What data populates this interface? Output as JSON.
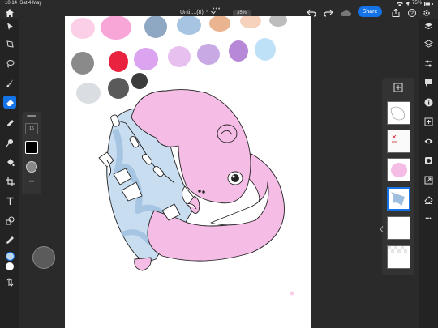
{
  "status": {
    "time": "10:14",
    "date": "Sat 4 May",
    "battery": "75%"
  },
  "header": {
    "doc_title": "Untit...(8)",
    "title_suffix": "*",
    "zoom": "35%",
    "share_label": "Share",
    "more_dots": "•••"
  },
  "brush_panel": {
    "size_value": "15"
  },
  "palette": {
    "swatches": [
      {
        "color": "#fbd0e6"
      },
      {
        "color": "#f7a6d7"
      },
      {
        "color": "#8ea7c2"
      },
      {
        "color": "#a7c4e2"
      },
      {
        "color": "#e9b48f"
      },
      {
        "color": "#f6d1bc"
      },
      {
        "color": "#bdbdbd"
      },
      {
        "color": "#8a8a8a"
      },
      {
        "color": "#e9233f"
      },
      {
        "color": "#dca3f0"
      },
      {
        "color": "#e7c0f0"
      },
      {
        "color": "#c8a9e4"
      },
      {
        "color": "#b788d8"
      },
      {
        "color": "#bfe1f8"
      },
      {
        "color": "#dadde1"
      },
      {
        "color": "#5a5a5a"
      },
      {
        "color": "#3c3c3c"
      }
    ]
  },
  "colors": {
    "accent": "#1473e6",
    "pink": "#f5bde5",
    "blue": "#9ebfe0",
    "primary_color": "#000000",
    "secondary_color": "#ffffff",
    "selected_color": "#bcd6ee"
  },
  "layers": [
    {
      "name": "sketch-layer",
      "selected": false
    },
    {
      "name": "lineart-layer",
      "selected": false
    },
    {
      "name": "pink-layer",
      "selected": false
    },
    {
      "name": "blue-layer",
      "selected": true
    },
    {
      "name": "blank-layer",
      "selected": false
    },
    {
      "name": "transparent-layer",
      "selected": false
    }
  ],
  "more_label": "•••"
}
